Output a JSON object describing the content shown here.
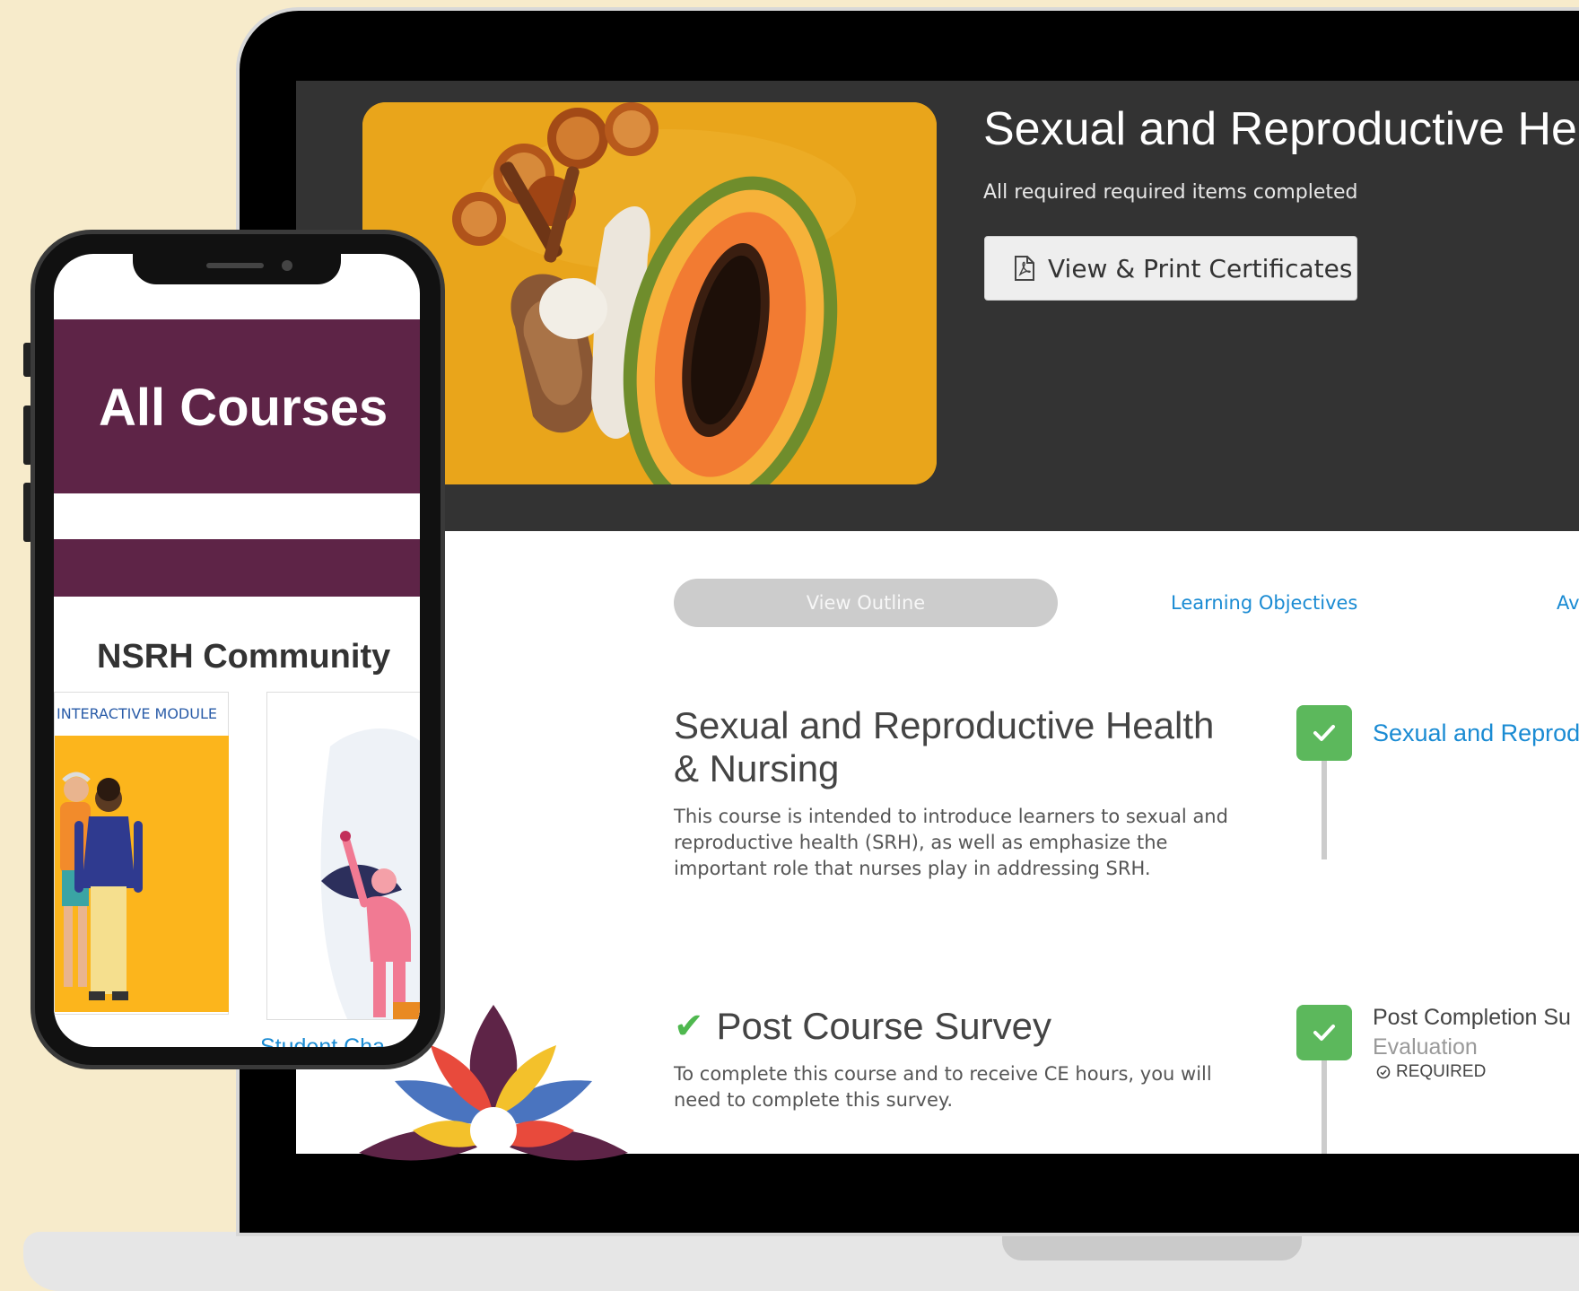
{
  "course": {
    "hero_title": "Sexual and Reproductive He",
    "status_text": "All required required items completed",
    "certificate_button": "View & Print Certificates"
  },
  "tabs": [
    {
      "label": "View Outline"
    },
    {
      "label": "Learning Objectives"
    },
    {
      "label": "Av"
    }
  ],
  "sections": [
    {
      "title_line1": "Sexual and Reproductive Health",
      "title_line2": "& Nursing",
      "description": "This course is intended to introduce learners to sexual and reproductive health (SRH), as well as emphasize the important role that nurses play in addressing SRH.",
      "timeline_label": "Sexual and Reprodu"
    },
    {
      "title": "Post Course Survey",
      "description": "To complete this course and to receive CE hours, you will need to complete this survey.",
      "timeline_label": "Post Completion Su",
      "timeline_type": "Evaluation",
      "timeline_badge": "REQUIRED"
    }
  ],
  "phone": {
    "banner_title": "All Courses",
    "community_heading": "NSRH Community",
    "card1_tag": "INTERACTIVE MODULE",
    "card2_caption": "Student Cha"
  },
  "colors": {
    "accent_blue": "#1a8bd3",
    "success_green": "#5cb85c",
    "brand_plum": "#5e2447",
    "hero_dark": "#333333",
    "background_cream": "#f7ebcb"
  }
}
